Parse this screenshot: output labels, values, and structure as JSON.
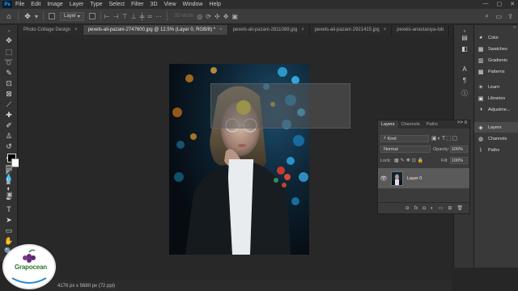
{
  "app": {
    "name": "Ps"
  },
  "menu": [
    "File",
    "Edit",
    "Image",
    "Layer",
    "Type",
    "Select",
    "Filter",
    "3D",
    "View",
    "Window",
    "Help"
  ],
  "window_controls": [
    "—",
    "▢",
    "✕"
  ],
  "options": {
    "layer_select": "Layer",
    "mode_3d": "3D Mode"
  },
  "tabs": [
    {
      "label": "Photo Collage Design",
      "active": false
    },
    {
      "label": "pexels-ali-pazani-2747600.jpg @ 12.5% (Layer 0, RGB/8) *",
      "active": true
    },
    {
      "label": "pexels-ali-pazani-2811089.jpg",
      "active": false
    },
    {
      "label": "pexels-ali-pazani-2921415.jpg",
      "active": false
    },
    {
      "label": "pexels-anastasiya-lob",
      "active": false
    }
  ],
  "tab_close": "×",
  "right_panels": [
    {
      "label": "Color",
      "icon": "color-icon"
    },
    {
      "label": "Swatches",
      "icon": "swatches-icon"
    },
    {
      "label": "Gradients",
      "icon": "gradients-icon"
    },
    {
      "label": "Patterns",
      "icon": "patterns-icon"
    },
    {
      "label": "Learn",
      "icon": "learn-icon"
    },
    {
      "label": "Libraries",
      "icon": "libraries-icon"
    },
    {
      "label": "Adjustme...",
      "icon": "adjustments-icon"
    },
    {
      "label": "Layers",
      "icon": "layers-icon"
    },
    {
      "label": "Channels",
      "icon": "channels-icon"
    },
    {
      "label": "Paths",
      "icon": "paths-icon"
    }
  ],
  "layers_panel": {
    "tabs": [
      "Layers",
      "Channels",
      "Paths"
    ],
    "menu": ">>  ≡",
    "kind_filter": "Kind",
    "blend_mode": "Normal",
    "opacity_label": "Opacity:",
    "opacity_value": "100%",
    "lock_label": "Lock:",
    "fill_label": "Fill:",
    "fill_value": "100%",
    "layers": [
      {
        "name": "Layer 0",
        "visible": true
      }
    ]
  },
  "status": {
    "doc_info": "4176 px x 5680 px (72 ppi)"
  },
  "watermark": {
    "brand": "Grapocean"
  },
  "colors": {
    "foreground": "#000000",
    "background": "#ffffff",
    "accent": "#31a8ff"
  }
}
